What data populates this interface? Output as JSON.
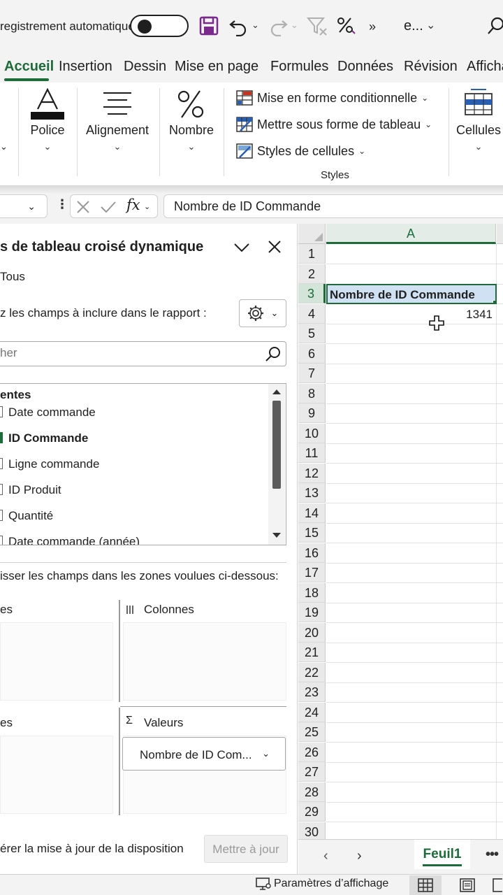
{
  "titlebar": {
    "autosave_label": "registrement automatique",
    "autosave_state": "off",
    "filename": "e...",
    "icons": [
      "save-icon",
      "undo-icon",
      "redo-icon",
      "clear-filter-icon",
      "percent-style-icon",
      "more-chevrons-icon",
      "search-icon"
    ]
  },
  "tabs": [
    "Accueil",
    "Insertion",
    "Dessin",
    "Mise en page",
    "Formules",
    "Données",
    "Révision",
    "Affichage"
  ],
  "active_tab": "Accueil",
  "ribbon": {
    "police": "Police",
    "alignement": "Alignement",
    "nombre": "Nombre",
    "mise_en_forme_cond": "Mise en forme conditionnelle",
    "mettre_sous_forme": "Mettre sous forme de tableau",
    "styles_cellules": "Styles de cellules",
    "styles_group": "Styles",
    "cellules": "Cellules"
  },
  "formula_bar": {
    "fx": "fx",
    "content": "Nombre de ID Commande"
  },
  "pivot_panel": {
    "title": "s de tableau croisé dynamique",
    "tous": "Tous",
    "choose_fields": "z les champs à inclure dans le rapport :",
    "search_placeholder": "her",
    "table_name": "entes",
    "fields": [
      {
        "label": "Date commande",
        "checked": false
      },
      {
        "label": "ID Commande",
        "checked": true
      },
      {
        "label": "Ligne commande",
        "checked": false
      },
      {
        "label": "ID Produit",
        "checked": false
      },
      {
        "label": "Quantité",
        "checked": false
      },
      {
        "label": "Date commande (année)",
        "checked": false
      }
    ],
    "drag_instructions": "isser les champs dans les zones voulues ci-dessous:",
    "zone_filtres": "es",
    "zone_colonnes": "Colonnes",
    "zone_lignes": "es",
    "zone_valeurs": "Valeurs",
    "value_field": "Nombre de ID Com...",
    "defer_update": "érer la mise à jour de la disposition",
    "update_button": "Mettre à jour"
  },
  "sheet": {
    "column": "A",
    "rows": [
      "1",
      "2",
      "3",
      "4",
      "5",
      "6",
      "7",
      "8",
      "9",
      "10",
      "11",
      "12",
      "13",
      "14",
      "15",
      "16",
      "17",
      "18",
      "19",
      "20",
      "21",
      "22",
      "23",
      "24",
      "25",
      "26",
      "27",
      "28",
      "29",
      "30"
    ],
    "selected_row": "3",
    "cell_a3": "Nombre de ID Commande",
    "cell_a4": "1341",
    "sheet_tab": "Feuil1",
    "more": "•••"
  },
  "statusbar": {
    "display_settings": "Paramètres d’affichage"
  },
  "colors": {
    "accent": "#1e6b3a",
    "selected_cell_fill": "#cfe1f3"
  }
}
